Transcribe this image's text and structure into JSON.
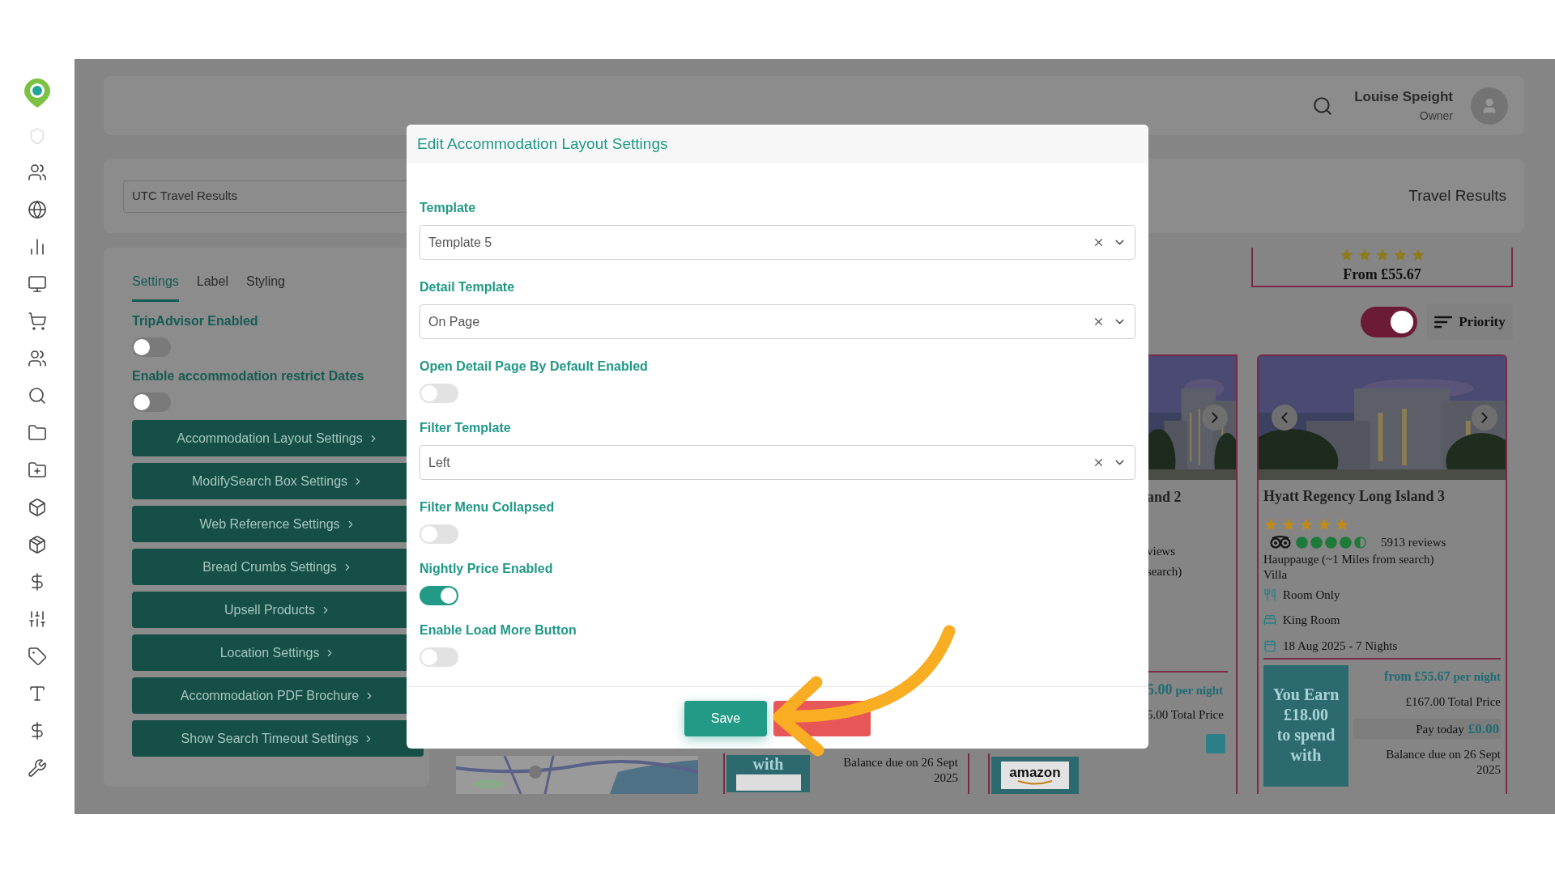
{
  "header": {
    "user_name": "Louise Speight",
    "user_role": "Owner"
  },
  "title_bar": {
    "name_value": "UTC Travel Results",
    "title": "Travel Results"
  },
  "settings_panel": {
    "tabs": [
      {
        "label": "Settings",
        "selected": true
      },
      {
        "label": "Label",
        "selected": false
      },
      {
        "label": "Styling",
        "selected": false
      }
    ],
    "toggles": [
      {
        "label": "TripAdvisor Enabled",
        "on": false
      },
      {
        "label": "Enable accommodation restrict Dates",
        "on": false
      }
    ],
    "buttons": [
      "Accommodation Layout Settings",
      "ModifySearch Box Settings",
      "Web Reference Settings",
      "Bread Crumbs Settings",
      "Upsell Products",
      "Location Settings",
      "Accommodation PDF Brochure",
      "Show Search Timeout Settings"
    ]
  },
  "results": {
    "summary_cell": {
      "stars": 5,
      "price": "From £55.67"
    },
    "view_toggle": {
      "on": true
    },
    "sort_button": "Priority",
    "card_a_fragment": {
      "earn_line": "with",
      "balance": "Balance due on 26 Sept 2025"
    },
    "card_b_fragment": {
      "title": "and 2",
      "reviews": "views",
      "location": "search)",
      "price": "5.00",
      "price_unit": "per night",
      "total": "5.00 Total Price",
      "logo": "amazon"
    },
    "card": {
      "title": "Hyatt Regency Long Island 3",
      "stars": 5,
      "tripadvisor": {
        "stars": 4.5,
        "reviews": "5913 reviews"
      },
      "location": "Hauppauge (~1 Miles from search)",
      "property_type": "Villa",
      "features": [
        {
          "kind": "board",
          "text": "Room Only"
        },
        {
          "kind": "room",
          "text": "King Room"
        },
        {
          "kind": "dates",
          "text": "18 Aug 2025 - 7 Nights"
        }
      ],
      "earn_lines": [
        "You Earn",
        "£18.00",
        "to spend",
        "with"
      ],
      "price": "from £55.67",
      "price_unit": "per night",
      "total": "£167.00 Total Price",
      "pay_today_label": "Pay today",
      "pay_today_amount": "£0.00",
      "balance": "Balance due on 26 Sept 2025"
    }
  },
  "dialog": {
    "title": "Edit Accommodation Layout Settings",
    "fields": [
      {
        "kind": "select",
        "label": "Template",
        "value": "Template 5"
      },
      {
        "kind": "select",
        "label": "Detail Template",
        "value": "On Page"
      },
      {
        "kind": "toggle",
        "label": "Open Detail Page By Default Enabled",
        "on": false
      },
      {
        "kind": "select",
        "label": "Filter Template",
        "value": "Left"
      },
      {
        "kind": "toggle",
        "label": "Filter Menu Collapsed",
        "on": false
      },
      {
        "kind": "toggle",
        "label": "Nightly Price Enabled",
        "on": true
      },
      {
        "kind": "toggle",
        "label": "Enable Load More Button",
        "on": false
      }
    ],
    "footer_buttons": [
      {
        "kind": "primary",
        "label": "Save"
      },
      {
        "kind": "danger"
      }
    ]
  }
}
